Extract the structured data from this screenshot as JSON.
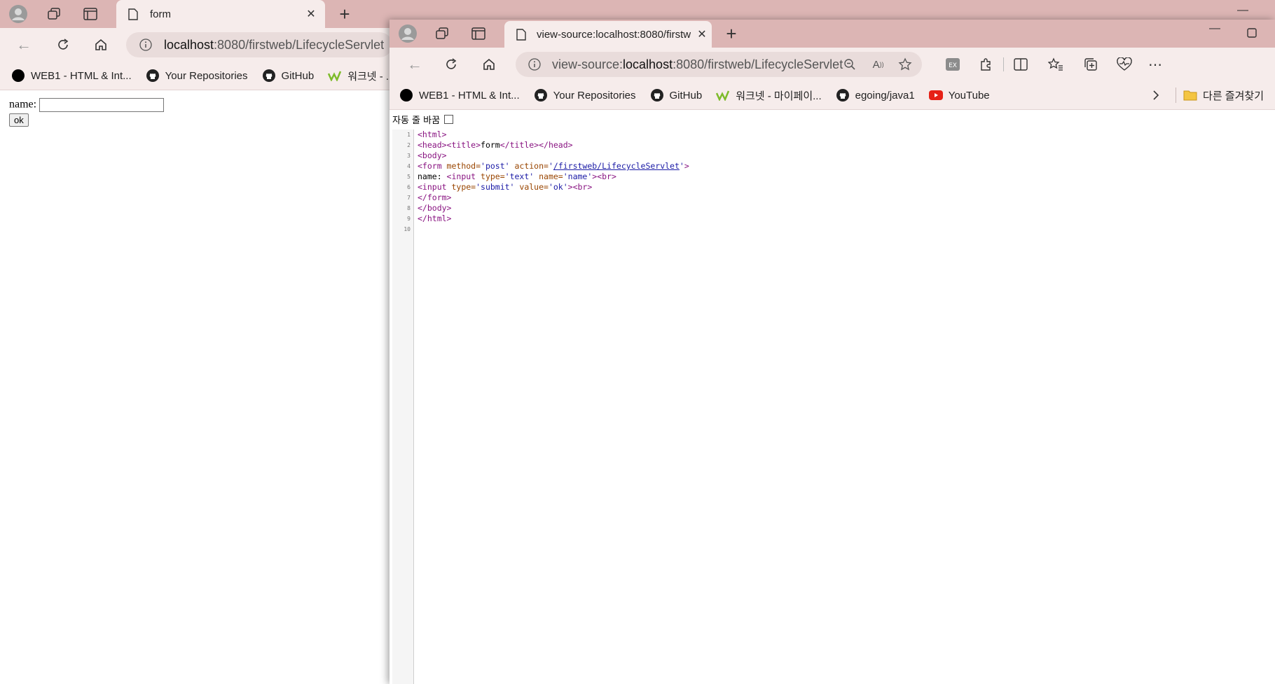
{
  "win1": {
    "tab_title": "form",
    "address_host": "localhost",
    "address_path": ":8080/firstweb/LifecycleServlet",
    "bookmarks": [
      "WEB1 - HTML & Int...",
      "Your Repositories",
      "GitHub",
      "워크넷 - ..."
    ],
    "form": {
      "label": "name:",
      "button": "ok"
    }
  },
  "win2": {
    "tab_title": "view-source:localhost:8080/firstw",
    "address_prefix": "view-source:",
    "address_host": "localhost",
    "address_path": ":8080/firstweb/LifecycleServlet",
    "bookmarks": [
      "WEB1 - HTML & Int...",
      "Your Repositories",
      "GitHub",
      "워크넷 - 마이페이...",
      "egoing/java1",
      "YouTube"
    ],
    "other_favorites": "다른 즐겨찾기",
    "wrap_label": "자동 줄 바꿈",
    "line_numbers": [
      "1",
      "2",
      "3",
      "4",
      "5",
      "6",
      "7",
      "8",
      "9",
      "10"
    ]
  },
  "colors": {
    "titlebar": "#dcb5b4",
    "toolbar": "#f6eceb",
    "tag": "#881280",
    "attr": "#994500",
    "value": "#1a1aa6"
  }
}
